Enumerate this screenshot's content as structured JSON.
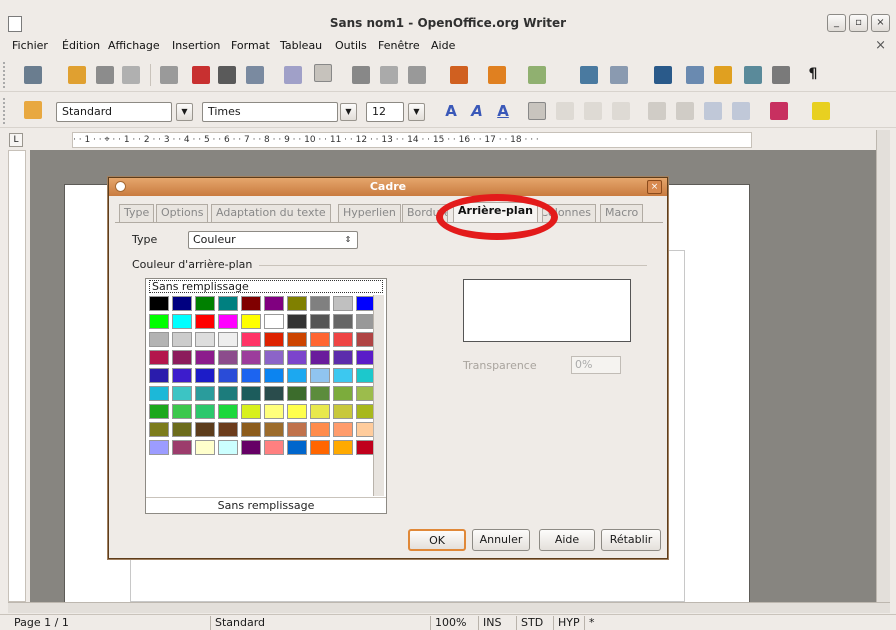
{
  "window": {
    "title": "Sans nom1 - OpenOffice.org Writer",
    "min": "_",
    "max": "▫",
    "close": "×"
  },
  "menu": [
    "Fichier",
    "Édition",
    "Affichage",
    "Insertion",
    "Format",
    "Tableau",
    "Outils",
    "Fenêtre",
    "Aide"
  ],
  "menu_close": "×",
  "format_bar": {
    "style": "Standard",
    "font": "Times",
    "size": "12"
  },
  "ruler_text": "· · 1 · · ⌖ · · 1 · · 2 · · 3 · · 4 · · 5 · · 6 · · 7 · · 8 · · 9 · · 10 · · 11 · · 12 · · 13 · · 14 · · 15 · · 16 · · 17 · · 18 · · ·",
  "dialog": {
    "title": "Cadre",
    "close": "×",
    "tabs": [
      "Type",
      "Options",
      "Adaptation du texte",
      "Hyperlien",
      "Bordures",
      "Arrière-plan",
      "Colonnes",
      "Macro"
    ],
    "active_tab": "Arrière-plan",
    "type_label": "Type",
    "type_value": "Couleur",
    "section_title": "Couleur d'arrière-plan",
    "no_fill_top": "Sans remplissage",
    "no_fill_caption": "Sans remplissage",
    "transparency_label": "Transparence",
    "transparency_value": "0%",
    "buttons": {
      "ok": "OK",
      "cancel": "Annuler",
      "help": "Aide",
      "reset": "Rétablir"
    },
    "swatches": [
      "#000000",
      "#000080",
      "#008000",
      "#008080",
      "#800000",
      "#800080",
      "#808000",
      "#808080",
      "#c0c0c0",
      "#0000ff",
      "#00ff00",
      "#00ffff",
      "#ff0000",
      "#ff00ff",
      "#ffff00",
      "#ffffff",
      "#333333",
      "#555555",
      "#666666",
      "#999999",
      "#b3b3b3",
      "#cccccc",
      "#dddddd",
      "#eeeeee",
      "#ff3366",
      "#dd2200",
      "#cc4400",
      "#ff6633",
      "#ee4444",
      "#b04444",
      "#b3164c",
      "#8c1c5c",
      "#8c1c8c",
      "#8c4c8c",
      "#9c3c9c",
      "#8c64c8",
      "#7c44cc",
      "#6a1c9c",
      "#5c2cac",
      "#5a1cc8",
      "#2a1cac",
      "#3c1ccc",
      "#1c1cc8",
      "#2a4cd8",
      "#1c64f0",
      "#0c84f0",
      "#1ca8f0",
      "#90c4f0",
      "#3cc8f0",
      "#1cc8cc",
      "#1cb8d8",
      "#3cc4c4",
      "#2a9c9c",
      "#1c7c7c",
      "#1c5c5c",
      "#2a4c4c",
      "#3c6c2c",
      "#5c8c3c",
      "#7cac3c",
      "#9cbc4c",
      "#1ca81c",
      "#3cc84c",
      "#2cc86c",
      "#1cd83c",
      "#d8f01c",
      "#ffff7c",
      "#ffff4c",
      "#e8e84c",
      "#c8c83c",
      "#a8b81c",
      "#7c7c1c",
      "#6c6c1c",
      "#5c3c1c",
      "#6c3c1c",
      "#8c5c1c",
      "#9c6c2c",
      "#c0724c",
      "#ff8c4c",
      "#ff9c6c",
      "#ffcc9c",
      "#9c9cff",
      "#9c3c6c",
      "#ffffcc",
      "#ccffff",
      "#660066",
      "#ff8080",
      "#0066cc",
      "#ff6600",
      "#ffaa00",
      "#c0001c"
    ]
  },
  "status": {
    "page": "Page 1 / 1",
    "style": "Standard",
    "zoom": "100%",
    "ins": "INS",
    "std": "STD",
    "hyp": "HYP",
    "star": "*"
  }
}
